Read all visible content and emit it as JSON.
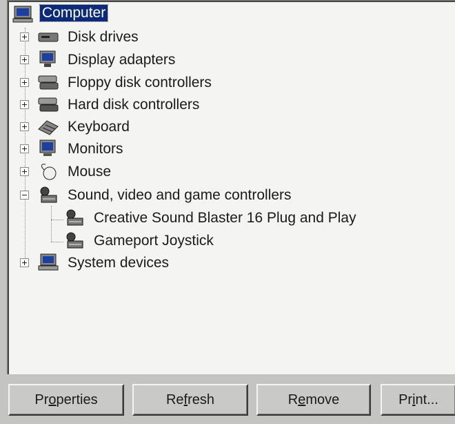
{
  "tree": {
    "root": {
      "label": "Computer",
      "icon": "computer-icon"
    },
    "items": [
      {
        "label": "Disk drives",
        "icon": "disk-drive-icon",
        "state": "collapsed"
      },
      {
        "label": "Display adapters",
        "icon": "display-adapter-icon",
        "state": "collapsed"
      },
      {
        "label": "Floppy disk controllers",
        "icon": "floppy-controller-icon",
        "state": "collapsed"
      },
      {
        "label": "Hard disk controllers",
        "icon": "hard-disk-controller-icon",
        "state": "collapsed"
      },
      {
        "label": "Keyboard",
        "icon": "keyboard-icon",
        "state": "collapsed"
      },
      {
        "label": "Monitors",
        "icon": "monitor-icon",
        "state": "collapsed"
      },
      {
        "label": "Mouse",
        "icon": "mouse-icon",
        "state": "collapsed"
      },
      {
        "label": "Sound, video and game controllers",
        "icon": "sound-controller-icon",
        "state": "expanded",
        "children": [
          {
            "label": "Creative Sound Blaster 16 Plug and Play",
            "icon": "sound-device-icon"
          },
          {
            "label": "Gameport Joystick",
            "icon": "joystick-device-icon"
          }
        ]
      },
      {
        "label": "System devices",
        "icon": "system-devices-icon",
        "state": "collapsed"
      }
    ]
  },
  "buttons": {
    "properties": {
      "pre": "Pr",
      "mn": "o",
      "post": "perties"
    },
    "refresh": {
      "pre": "Re",
      "mn": "f",
      "post": "resh"
    },
    "remove": {
      "pre": "R",
      "mn": "e",
      "post": "move"
    },
    "print": {
      "pre": "Pr",
      "mn": "i",
      "post": "nt..."
    }
  },
  "colors": {
    "selection": "#0c2a7a",
    "panel": "#f4f5f3",
    "face": "#c4c5c3"
  }
}
